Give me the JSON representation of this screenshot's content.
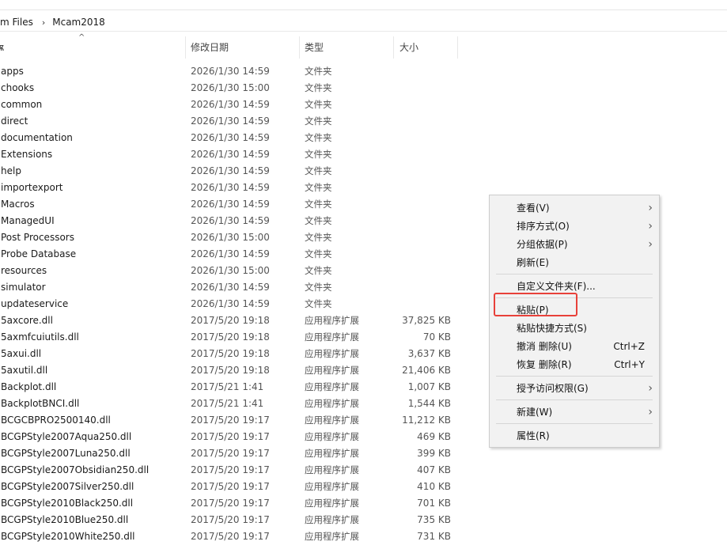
{
  "breadcrumb": {
    "parent": "m Files",
    "separator": "›",
    "current": "Mcam2018"
  },
  "headers": {
    "sort_indicator": "^",
    "name": "ѫ",
    "date": "修改日期",
    "type": "类型",
    "size": "大小"
  },
  "files": [
    {
      "name": "apps",
      "date": "2026/1/30 14:59",
      "type": "文件夹",
      "size": ""
    },
    {
      "name": "chooks",
      "date": "2026/1/30 15:00",
      "type": "文件夹",
      "size": ""
    },
    {
      "name": "common",
      "date": "2026/1/30 14:59",
      "type": "文件夹",
      "size": ""
    },
    {
      "name": "direct",
      "date": "2026/1/30 14:59",
      "type": "文件夹",
      "size": ""
    },
    {
      "name": "documentation",
      "date": "2026/1/30 14:59",
      "type": "文件夹",
      "size": ""
    },
    {
      "name": "Extensions",
      "date": "2026/1/30 14:59",
      "type": "文件夹",
      "size": ""
    },
    {
      "name": "help",
      "date": "2026/1/30 14:59",
      "type": "文件夹",
      "size": ""
    },
    {
      "name": "importexport",
      "date": "2026/1/30 14:59",
      "type": "文件夹",
      "size": ""
    },
    {
      "name": "Macros",
      "date": "2026/1/30 14:59",
      "type": "文件夹",
      "size": ""
    },
    {
      "name": "ManagedUI",
      "date": "2026/1/30 14:59",
      "type": "文件夹",
      "size": ""
    },
    {
      "name": "Post Processors",
      "date": "2026/1/30 15:00",
      "type": "文件夹",
      "size": ""
    },
    {
      "name": "Probe Database",
      "date": "2026/1/30 14:59",
      "type": "文件夹",
      "size": ""
    },
    {
      "name": "resources",
      "date": "2026/1/30 15:00",
      "type": "文件夹",
      "size": ""
    },
    {
      "name": "simulator",
      "date": "2026/1/30 14:59",
      "type": "文件夹",
      "size": ""
    },
    {
      "name": "updateservice",
      "date": "2026/1/30 14:59",
      "type": "文件夹",
      "size": ""
    },
    {
      "name": "5axcore.dll",
      "date": "2017/5/20 19:18",
      "type": "应用程序扩展",
      "size": "37,825 KB"
    },
    {
      "name": "5axmfcuiutils.dll",
      "date": "2017/5/20 19:18",
      "type": "应用程序扩展",
      "size": "70 KB"
    },
    {
      "name": "5axui.dll",
      "date": "2017/5/20 19:18",
      "type": "应用程序扩展",
      "size": "3,637 KB"
    },
    {
      "name": "5axutil.dll",
      "date": "2017/5/20 19:18",
      "type": "应用程序扩展",
      "size": "21,406 KB"
    },
    {
      "name": "Backplot.dll",
      "date": "2017/5/21 1:41",
      "type": "应用程序扩展",
      "size": "1,007 KB"
    },
    {
      "name": "BackplotBNCI.dll",
      "date": "2017/5/21 1:41",
      "type": "应用程序扩展",
      "size": "1,544 KB"
    },
    {
      "name": "BCGCBPRO2500140.dll",
      "date": "2017/5/20 19:17",
      "type": "应用程序扩展",
      "size": "11,212 KB"
    },
    {
      "name": "BCGPStyle2007Aqua250.dll",
      "date": "2017/5/20 19:17",
      "type": "应用程序扩展",
      "size": "469 KB"
    },
    {
      "name": "BCGPStyle2007Luna250.dll",
      "date": "2017/5/20 19:17",
      "type": "应用程序扩展",
      "size": "399 KB"
    },
    {
      "name": "BCGPStyle2007Obsidian250.dll",
      "date": "2017/5/20 19:17",
      "type": "应用程序扩展",
      "size": "407 KB"
    },
    {
      "name": "BCGPStyle2007Silver250.dll",
      "date": "2017/5/20 19:17",
      "type": "应用程序扩展",
      "size": "410 KB"
    },
    {
      "name": "BCGPStyle2010Black250.dll",
      "date": "2017/5/20 19:17",
      "type": "应用程序扩展",
      "size": "701 KB"
    },
    {
      "name": "BCGPStyle2010Blue250.dll",
      "date": "2017/5/20 19:17",
      "type": "应用程序扩展",
      "size": "735 KB"
    },
    {
      "name": "BCGPStyle2010White250.dll",
      "date": "2017/5/20 19:17",
      "type": "应用程序扩展",
      "size": "731 KB"
    }
  ],
  "context_menu": {
    "view": "查看(V)",
    "sort_by": "排序方式(O)",
    "group_by": "分组依据(P)",
    "refresh": "刷新(E)",
    "customize": "自定义文件夹(F)...",
    "paste": "粘贴(P)",
    "paste_shortcut": "粘贴快捷方式(S)",
    "undo_delete": "撤消 删除(U)",
    "undo_shortcut": "Ctrl+Z",
    "redo_delete": "恢复 删除(R)",
    "redo_shortcut": "Ctrl+Y",
    "grant_access": "授予访问权限(G)",
    "new": "新建(W)",
    "properties": "属性(R)",
    "submenu_glyph": "›"
  },
  "colors": {
    "highlight_box": "#e8413a",
    "menu_bg": "#f2f2f2"
  }
}
